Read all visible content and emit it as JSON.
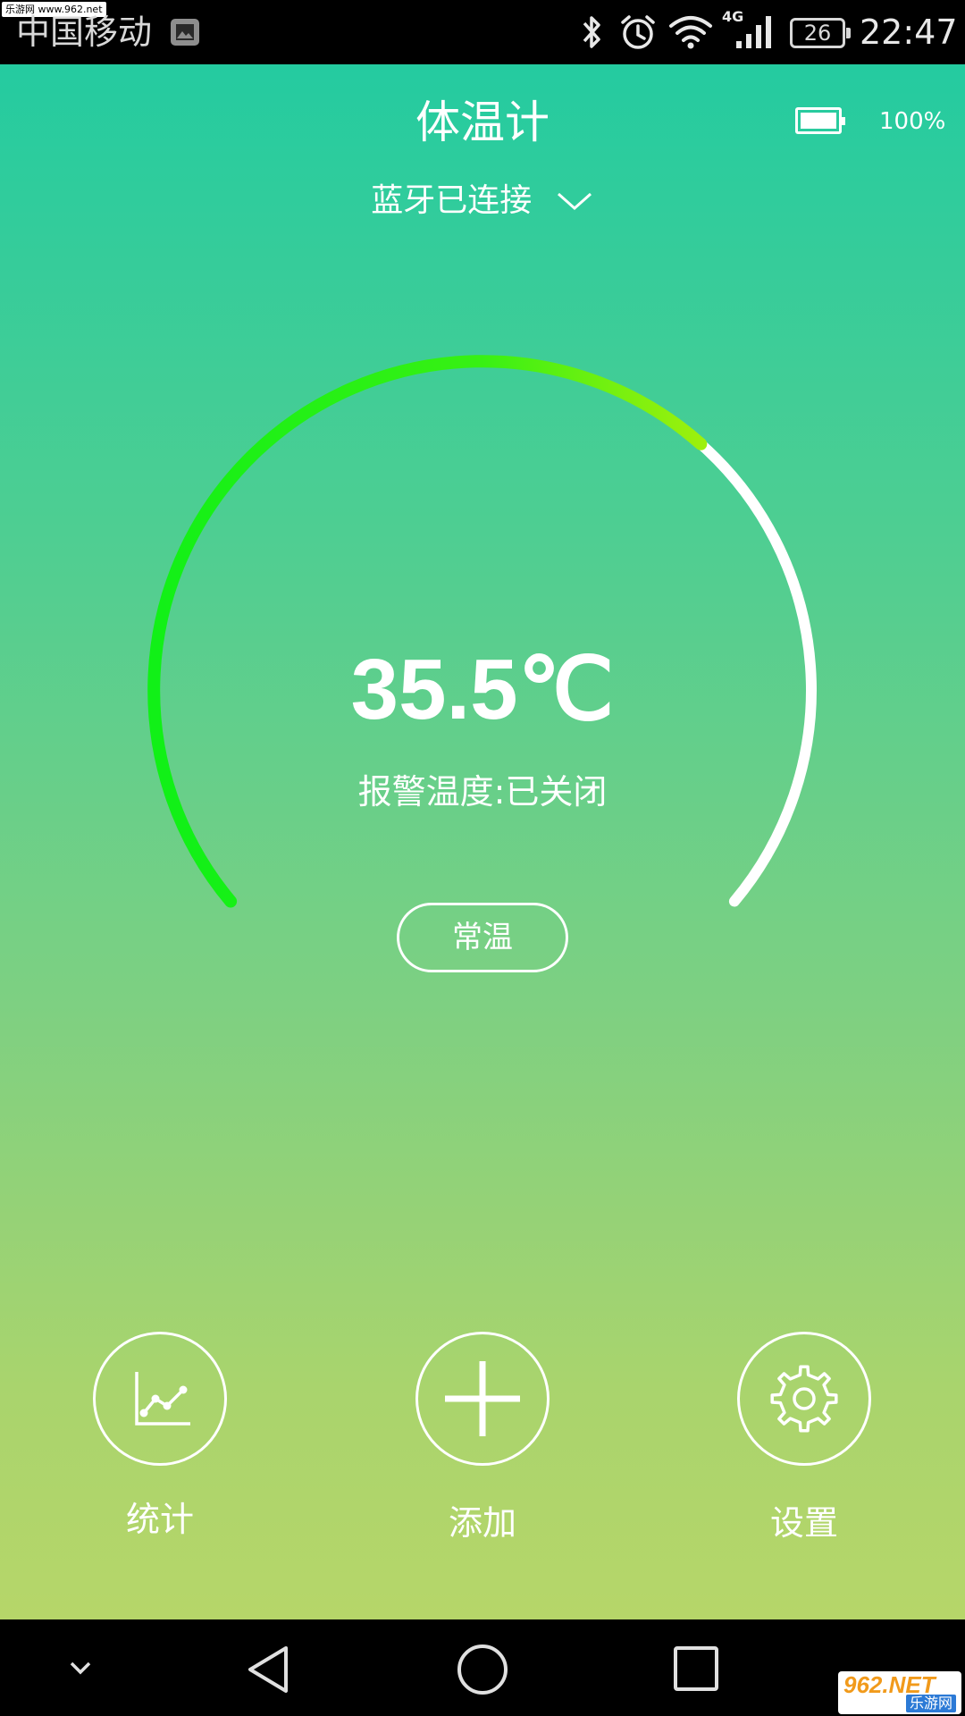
{
  "status_bar": {
    "watermark": "乐游网 www.962.net",
    "carrier": "中国移动",
    "network_type": "4G",
    "battery_level": "26",
    "time": "22:47"
  },
  "header": {
    "title": "体温计",
    "device_battery_level": "100%",
    "bluetooth_status": "蓝牙已连接"
  },
  "gauge": {
    "temperature": "35.5℃",
    "alarm_status": "报警温度:已关闭",
    "state_label": "常温",
    "progress_fraction": 0.66,
    "colors": {
      "start": "#11f017",
      "end": "#c4f00a",
      "track": "#ffffff"
    }
  },
  "actions": {
    "stats_label": "统计",
    "add_label": "添加",
    "settings_label": "设置"
  },
  "watermark_bottom": {
    "main": "962.NET",
    "sub": "乐游网"
  }
}
